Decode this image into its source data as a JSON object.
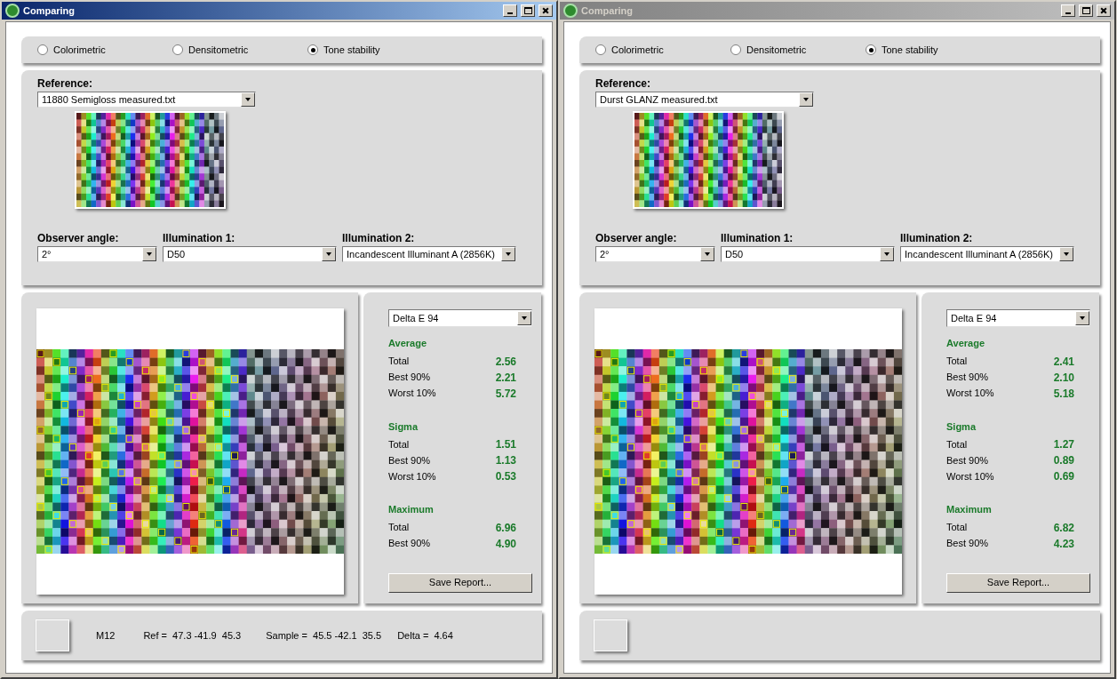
{
  "windows": [
    {
      "title": "Comparing",
      "active": true,
      "modes": [
        {
          "label": "Colorimetric",
          "selected": false
        },
        {
          "label": "Densitometric",
          "selected": false
        },
        {
          "label": "Tone stability",
          "selected": true
        }
      ],
      "reference": {
        "label": "Reference:",
        "value": "11880 Semigloss measured.txt"
      },
      "settings": [
        {
          "label": "Observer angle:",
          "value": "2°"
        },
        {
          "label": "Illumination 1:",
          "value": "D50"
        },
        {
          "label": "Illumination 2:",
          "value": "Incandescent Illuminant A (2856K)"
        }
      ],
      "metric": "Delta E 94",
      "groups": [
        {
          "title": "Average",
          "rows": [
            {
              "label": "Total",
              "value": "2.56"
            },
            {
              "label": "Best 90%",
              "value": "2.21"
            },
            {
              "label": "Worst 10%",
              "value": "5.72"
            }
          ]
        },
        {
          "title": "Sigma",
          "rows": [
            {
              "label": "Total",
              "value": "1.51"
            },
            {
              "label": "Best 90%",
              "value": "1.13"
            },
            {
              "label": "Worst 10%",
              "value": "0.53"
            }
          ]
        },
        {
          "title": "Maximum",
          "rows": [
            {
              "label": "Total",
              "value": "6.96"
            },
            {
              "label": "Best 90%",
              "value": "4.90"
            }
          ]
        }
      ],
      "save_button": "Save Report...",
      "status": {
        "patch": "M12",
        "ref": "Ref =  47.3 -41.9  45.3",
        "sample": "Sample =  45.5 -42.1  35.5",
        "delta": "Delta =  4.64"
      }
    },
    {
      "title": "Comparing",
      "active": false,
      "modes": [
        {
          "label": "Colorimetric",
          "selected": false
        },
        {
          "label": "Densitometric",
          "selected": false
        },
        {
          "label": "Tone stability",
          "selected": true
        }
      ],
      "reference": {
        "label": "Reference:",
        "value": "Durst GLANZ measured.txt"
      },
      "settings": [
        {
          "label": "Observer angle:",
          "value": "2°"
        },
        {
          "label": "Illumination 1:",
          "value": "D50"
        },
        {
          "label": "Illumination 2:",
          "value": "Incandescent Illuminant A (2856K)"
        }
      ],
      "metric": "Delta E 94",
      "groups": [
        {
          "title": "Average",
          "rows": [
            {
              "label": "Total",
              "value": "2.41"
            },
            {
              "label": "Best 90%",
              "value": "2.10"
            },
            {
              "label": "Worst 10%",
              "value": "5.18"
            }
          ]
        },
        {
          "title": "Sigma",
          "rows": [
            {
              "label": "Total",
              "value": "1.27"
            },
            {
              "label": "Best 90%",
              "value": "0.89"
            },
            {
              "label": "Worst 10%",
              "value": "0.69"
            }
          ]
        },
        {
          "title": "Maximum",
          "rows": [
            {
              "label": "Total",
              "value": "6.82"
            },
            {
              "label": "Best 90%",
              "value": "4.23"
            }
          ]
        }
      ],
      "save_button": "Save Report..."
    }
  ]
}
